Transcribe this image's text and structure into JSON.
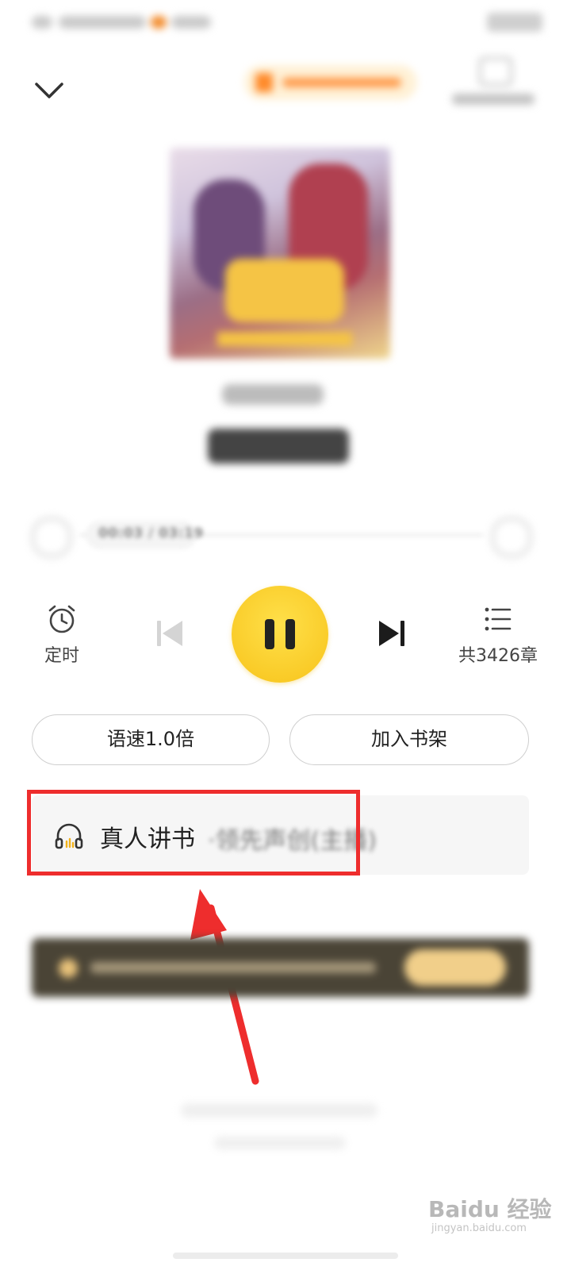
{
  "player": {
    "time": "00:03 / 03:19",
    "timer_label": "定时",
    "chapters_label": "共3426章"
  },
  "actions": {
    "speed_label": "语速1.0倍",
    "shelf_label": "加入书架"
  },
  "narrator": {
    "label": "真人讲书",
    "extra": "·领先声创(主播)"
  },
  "watermark": {
    "main": "Baidu 经验",
    "sub": "jingyan.baidu.com"
  },
  "colors": {
    "play_button": "#f7c31a",
    "highlight_box": "#ee2d2d",
    "arrow": "#ee2d2d",
    "vip_banner": "#4a4436"
  }
}
